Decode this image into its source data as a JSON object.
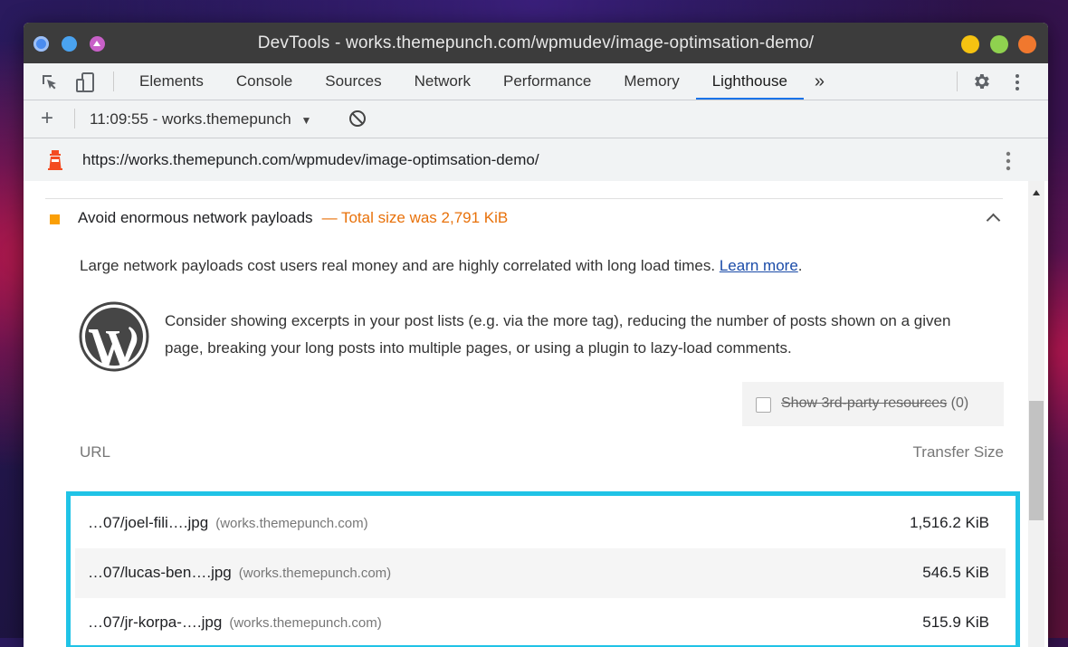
{
  "window": {
    "title": "DevTools - works.themepunch.com/wpmudev/image-optimsation-demo/"
  },
  "toolbar": {
    "tabs": [
      {
        "label": "Elements"
      },
      {
        "label": "Console"
      },
      {
        "label": "Sources"
      },
      {
        "label": "Network"
      },
      {
        "label": "Performance"
      },
      {
        "label": "Memory"
      },
      {
        "label": "Lighthouse"
      }
    ],
    "active_tab": "Lighthouse",
    "more_label": "»"
  },
  "subbar": {
    "report_select": "11:09:55 - works.themepunch"
  },
  "urlbar": {
    "url": "https://works.themepunch.com/wpmudev/image-optimsation-demo/"
  },
  "audit": {
    "title": "Avoid enormous network payloads",
    "display_value": "— Total size was 2,791 KiB",
    "description": "Large network payloads cost users real money and are highly correlated with long load times.",
    "learn_more": "Learn more",
    "period": ".",
    "stack_pack": "Consider showing excerpts in your post lists (e.g. via the more tag), reducing the number of posts shown on a given page, breaking your long posts into multiple pages, or using a plugin to lazy-load comments.",
    "filter_label": "Show 3rd-party resources",
    "filter_count": "(0)",
    "col_url": "URL",
    "col_size": "Transfer Size",
    "rows": [
      {
        "file": "…07/joel-fili….jpg",
        "host": "(works.themepunch.com)",
        "size": "1,516.2 KiB"
      },
      {
        "file": "…07/lucas-ben….jpg",
        "host": "(works.themepunch.com)",
        "size": "546.5 KiB"
      },
      {
        "file": "…07/jr-korpa-….jpg",
        "host": "(works.themepunch.com)",
        "size": "515.9 KiB"
      }
    ]
  },
  "colors": {
    "accent": "#1a73e8",
    "warning": "#e8710a",
    "highlight": "#20c3e6"
  }
}
